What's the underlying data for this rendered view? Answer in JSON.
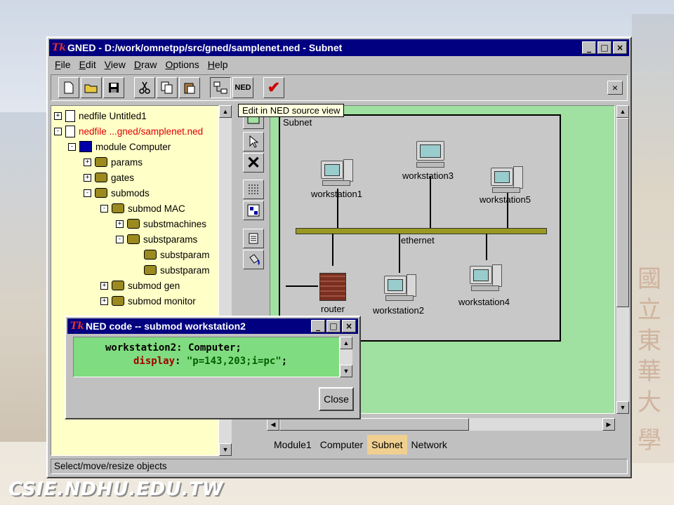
{
  "watermark": "CSIE.NDHU.EDU.TW",
  "background_glyphs": [
    "國",
    "立",
    "東",
    "華",
    "大",
    "學"
  ],
  "window": {
    "title": "GNED - D:/work/omnetpp/src/gned/samplenet.ned - Subnet",
    "logo": "Tk",
    "buttons": [
      "_",
      "□",
      "×"
    ]
  },
  "menu": [
    {
      "key": "F",
      "rest": "ile"
    },
    {
      "key": "E",
      "rest": "dit"
    },
    {
      "key": "V",
      "rest": "iew"
    },
    {
      "key": "D",
      "rest": "raw"
    },
    {
      "key": "O",
      "rest": "ptions"
    },
    {
      "key": "H",
      "rest": "elp"
    }
  ],
  "toolbar": {
    "ned_label": "NED",
    "tooltip": "Edit in NED source view"
  },
  "tree": [
    {
      "label": "nedfile Untitled1",
      "exp": "+",
      "icon": "doc",
      "red": false
    },
    {
      "label": "nedfile ...gned/samplenet.ned",
      "exp": "-",
      "icon": "doc",
      "red": true
    },
    {
      "label": "module Computer",
      "exp": "-",
      "icon": "module",
      "red": false
    },
    {
      "label": "params",
      "exp": "+",
      "icon": "gear",
      "red": false
    },
    {
      "label": "gates",
      "exp": "+",
      "icon": "gear",
      "red": false
    },
    {
      "label": "submods",
      "exp": "-",
      "icon": "gear",
      "red": false
    },
    {
      "label": "submod MAC",
      "exp": "-",
      "icon": "gear",
      "red": false
    },
    {
      "label": "substmachines",
      "exp": "+",
      "icon": "gear",
      "red": false
    },
    {
      "label": "substparams",
      "exp": "-",
      "icon": "gear",
      "red": false
    },
    {
      "label": "substparam",
      "exp": "",
      "icon": "gear",
      "red": false
    },
    {
      "label": "substparam",
      "exp": "",
      "icon": "gear",
      "red": false
    },
    {
      "label": "submod gen",
      "exp": "+",
      "icon": "gear",
      "red": false
    },
    {
      "label": "submod monitor",
      "exp": "+",
      "icon": "gear",
      "red": false
    }
  ],
  "canvas": {
    "compound_label": "Subnet",
    "channel_label": "ethernet",
    "nodes": [
      {
        "label": "workstation1"
      },
      {
        "label": "workstation3"
      },
      {
        "label": "workstation5"
      },
      {
        "label": "router"
      },
      {
        "label": "workstation2"
      },
      {
        "label": "workstation4"
      }
    ]
  },
  "tabs": [
    {
      "label": "Module1",
      "active": false
    },
    {
      "label": "Computer",
      "active": false
    },
    {
      "label": "Subnet",
      "active": true
    },
    {
      "label": "Network",
      "active": false
    }
  ],
  "status": "Select/move/resize objects",
  "popup": {
    "title": "NED code -- submod workstation2",
    "code_line1": "workstation2: Computer;",
    "code_kw": "display",
    "code_colon": ": ",
    "code_str": "\"p=143,203;i=pc\"",
    "code_end": ";",
    "close_label": "Close"
  },
  "colors": {
    "titlebar": "#000080",
    "tree_bg": "#ffffc8",
    "canvas_bg": "#a0e0a0",
    "ethernet": "#999922",
    "active_tab": "#f0d090"
  }
}
